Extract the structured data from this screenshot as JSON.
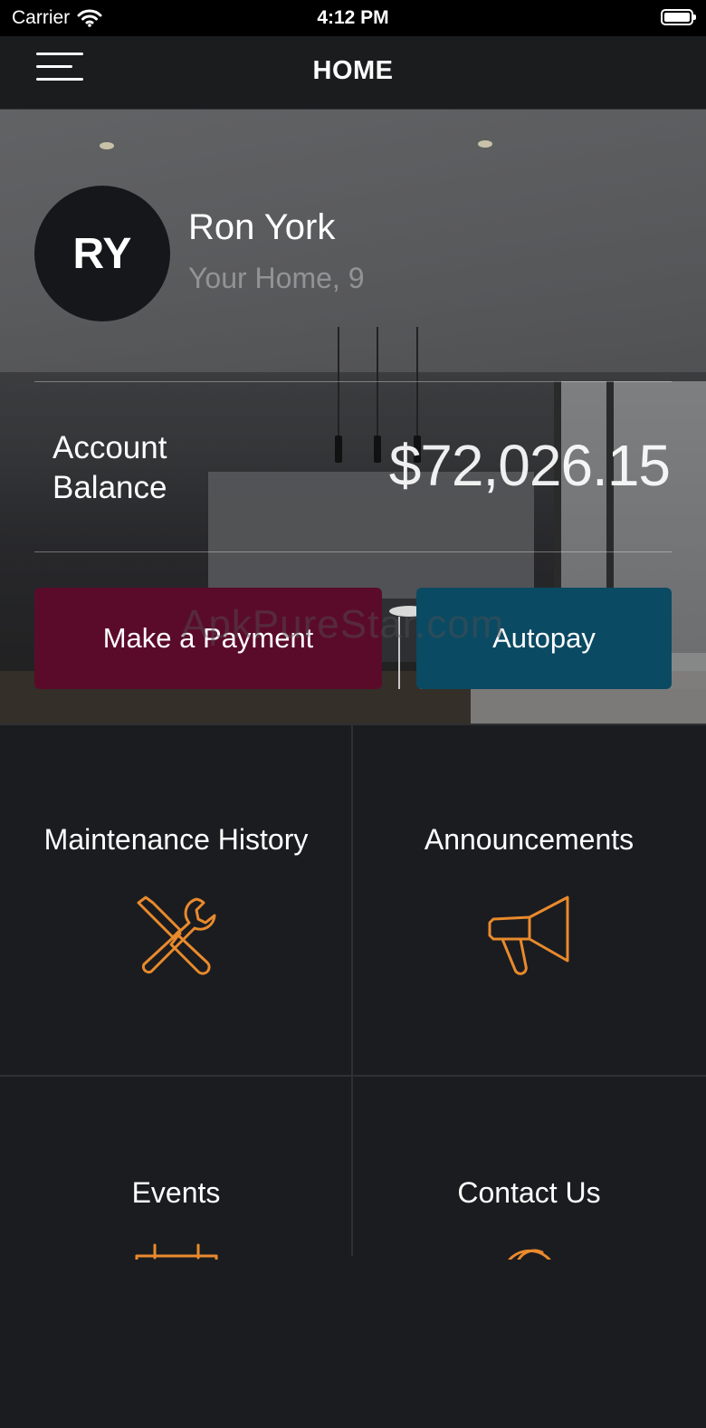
{
  "status_bar": {
    "carrier": "Carrier",
    "time": "4:12 PM"
  },
  "nav": {
    "title": "HOME"
  },
  "profile": {
    "initials": "RY",
    "name": "Ron York",
    "home": "Your Home, 9"
  },
  "balance": {
    "label": "Account Balance",
    "amount": "$72,026.15"
  },
  "actions": {
    "pay_label": "Make a Payment",
    "autopay_label": "Autopay"
  },
  "watermark": "ApkPureStar.com",
  "tiles": [
    {
      "label": "Maintenance History",
      "icon": "wrench-screwdriver-icon"
    },
    {
      "label": "Announcements",
      "icon": "megaphone-icon"
    },
    {
      "label": "Events",
      "icon": "calendar-icon"
    },
    {
      "label": "Contact Us",
      "icon": "chat-icon"
    }
  ],
  "colors": {
    "accent": "#e98a2c",
    "pay": "#5b0b2a",
    "autopay": "#0b4a63",
    "background": "#1b1c20"
  }
}
